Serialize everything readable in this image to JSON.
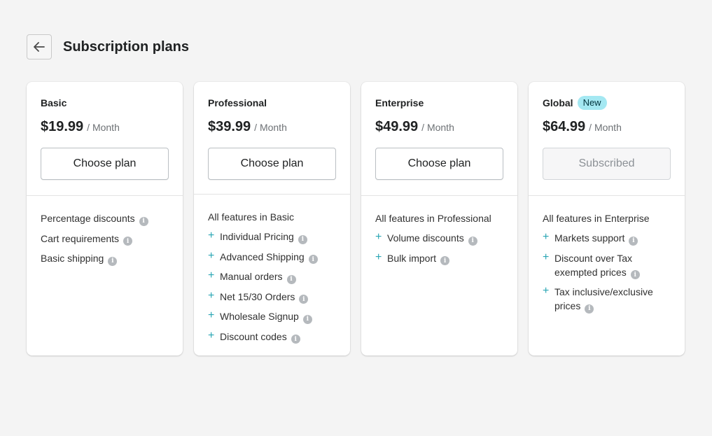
{
  "header": {
    "title": "Subscription plans",
    "back_icon": "arrow-left-icon"
  },
  "plans": [
    {
      "name": "Basic",
      "badge": "",
      "price": "$19.99",
      "period": "/ Month",
      "button": "Choose plan",
      "button_disabled": false,
      "intro": "",
      "features": [
        "Percentage discounts",
        "Cart requirements",
        "Basic shipping"
      ]
    },
    {
      "name": "Professional",
      "badge": "",
      "price": "$39.99",
      "period": "/ Month",
      "button": "Choose plan",
      "button_disabled": false,
      "intro": "All features in Basic",
      "features": [
        "Individual Pricing",
        "Advanced Shipping",
        "Manual orders",
        "Net 15/30 Orders",
        "Wholesale Signup",
        "Discount codes"
      ]
    },
    {
      "name": "Enterprise",
      "badge": "",
      "price": "$49.99",
      "period": "/ Month",
      "button": "Choose plan",
      "button_disabled": false,
      "intro": "All features in Professional",
      "features": [
        "Volume discounts",
        "Bulk import"
      ]
    },
    {
      "name": "Global",
      "badge": "New",
      "price": "$64.99",
      "period": "/ Month",
      "button": "Subscribed",
      "button_disabled": true,
      "intro": "All features in Enterprise",
      "features": [
        "Markets support",
        "Discount over Tax exempted prices",
        "Tax inclusive/exclusive prices"
      ]
    }
  ],
  "colors": {
    "accent_plus": "#2aa6b4",
    "badge_bg": "#a4e8f2",
    "page_bg": "#f4f4f4"
  }
}
